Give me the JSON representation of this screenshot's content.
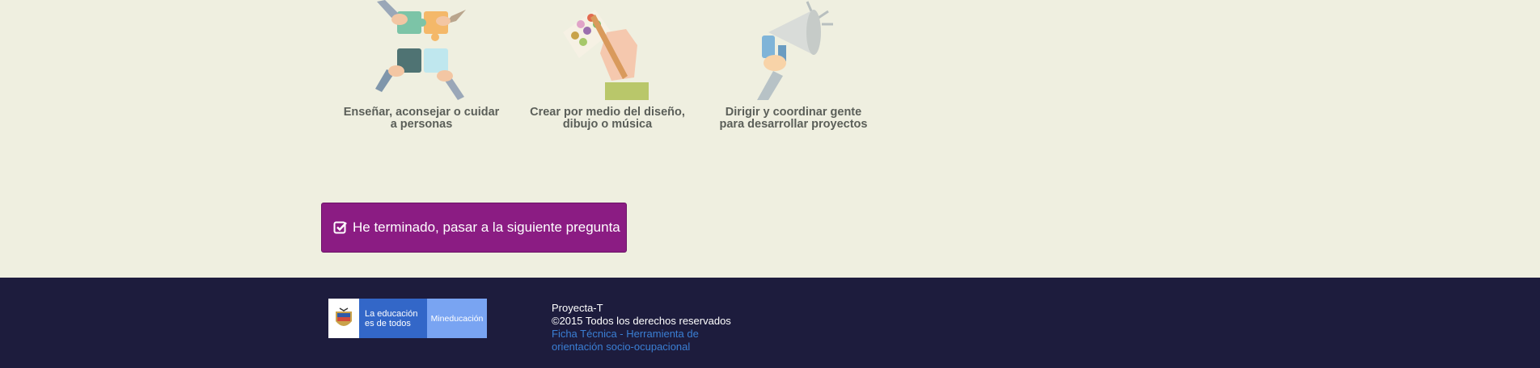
{
  "options": [
    {
      "icon": "puzzle-hands-icon",
      "label_line1": "Enseñar, aconsejar o cuidar",
      "label_line2": "a personas"
    },
    {
      "icon": "paint-palette-icon",
      "label_line1": "Crear por medio del diseño,",
      "label_line2": "dibujo o música"
    },
    {
      "icon": "megaphone-icon",
      "label_line1": "Dirigir y coordinar gente",
      "label_line2": "para desarrollar proyectos"
    }
  ],
  "next_button": {
    "label": "He terminado, pasar a la siguiente pregunta",
    "icon": "check-square-icon",
    "color": "#8b1c83"
  },
  "footer": {
    "logo": {
      "line1": "La educación",
      "line2": "es de todos",
      "ministry": "Mineducación"
    },
    "app_name": "Proyecta-T",
    "copyright": "©2015 Todos los derechos reservados",
    "link": "Ficha Técnica - Herramienta de orientación socio-ocupacional",
    "background": "#1d1c3d"
  }
}
